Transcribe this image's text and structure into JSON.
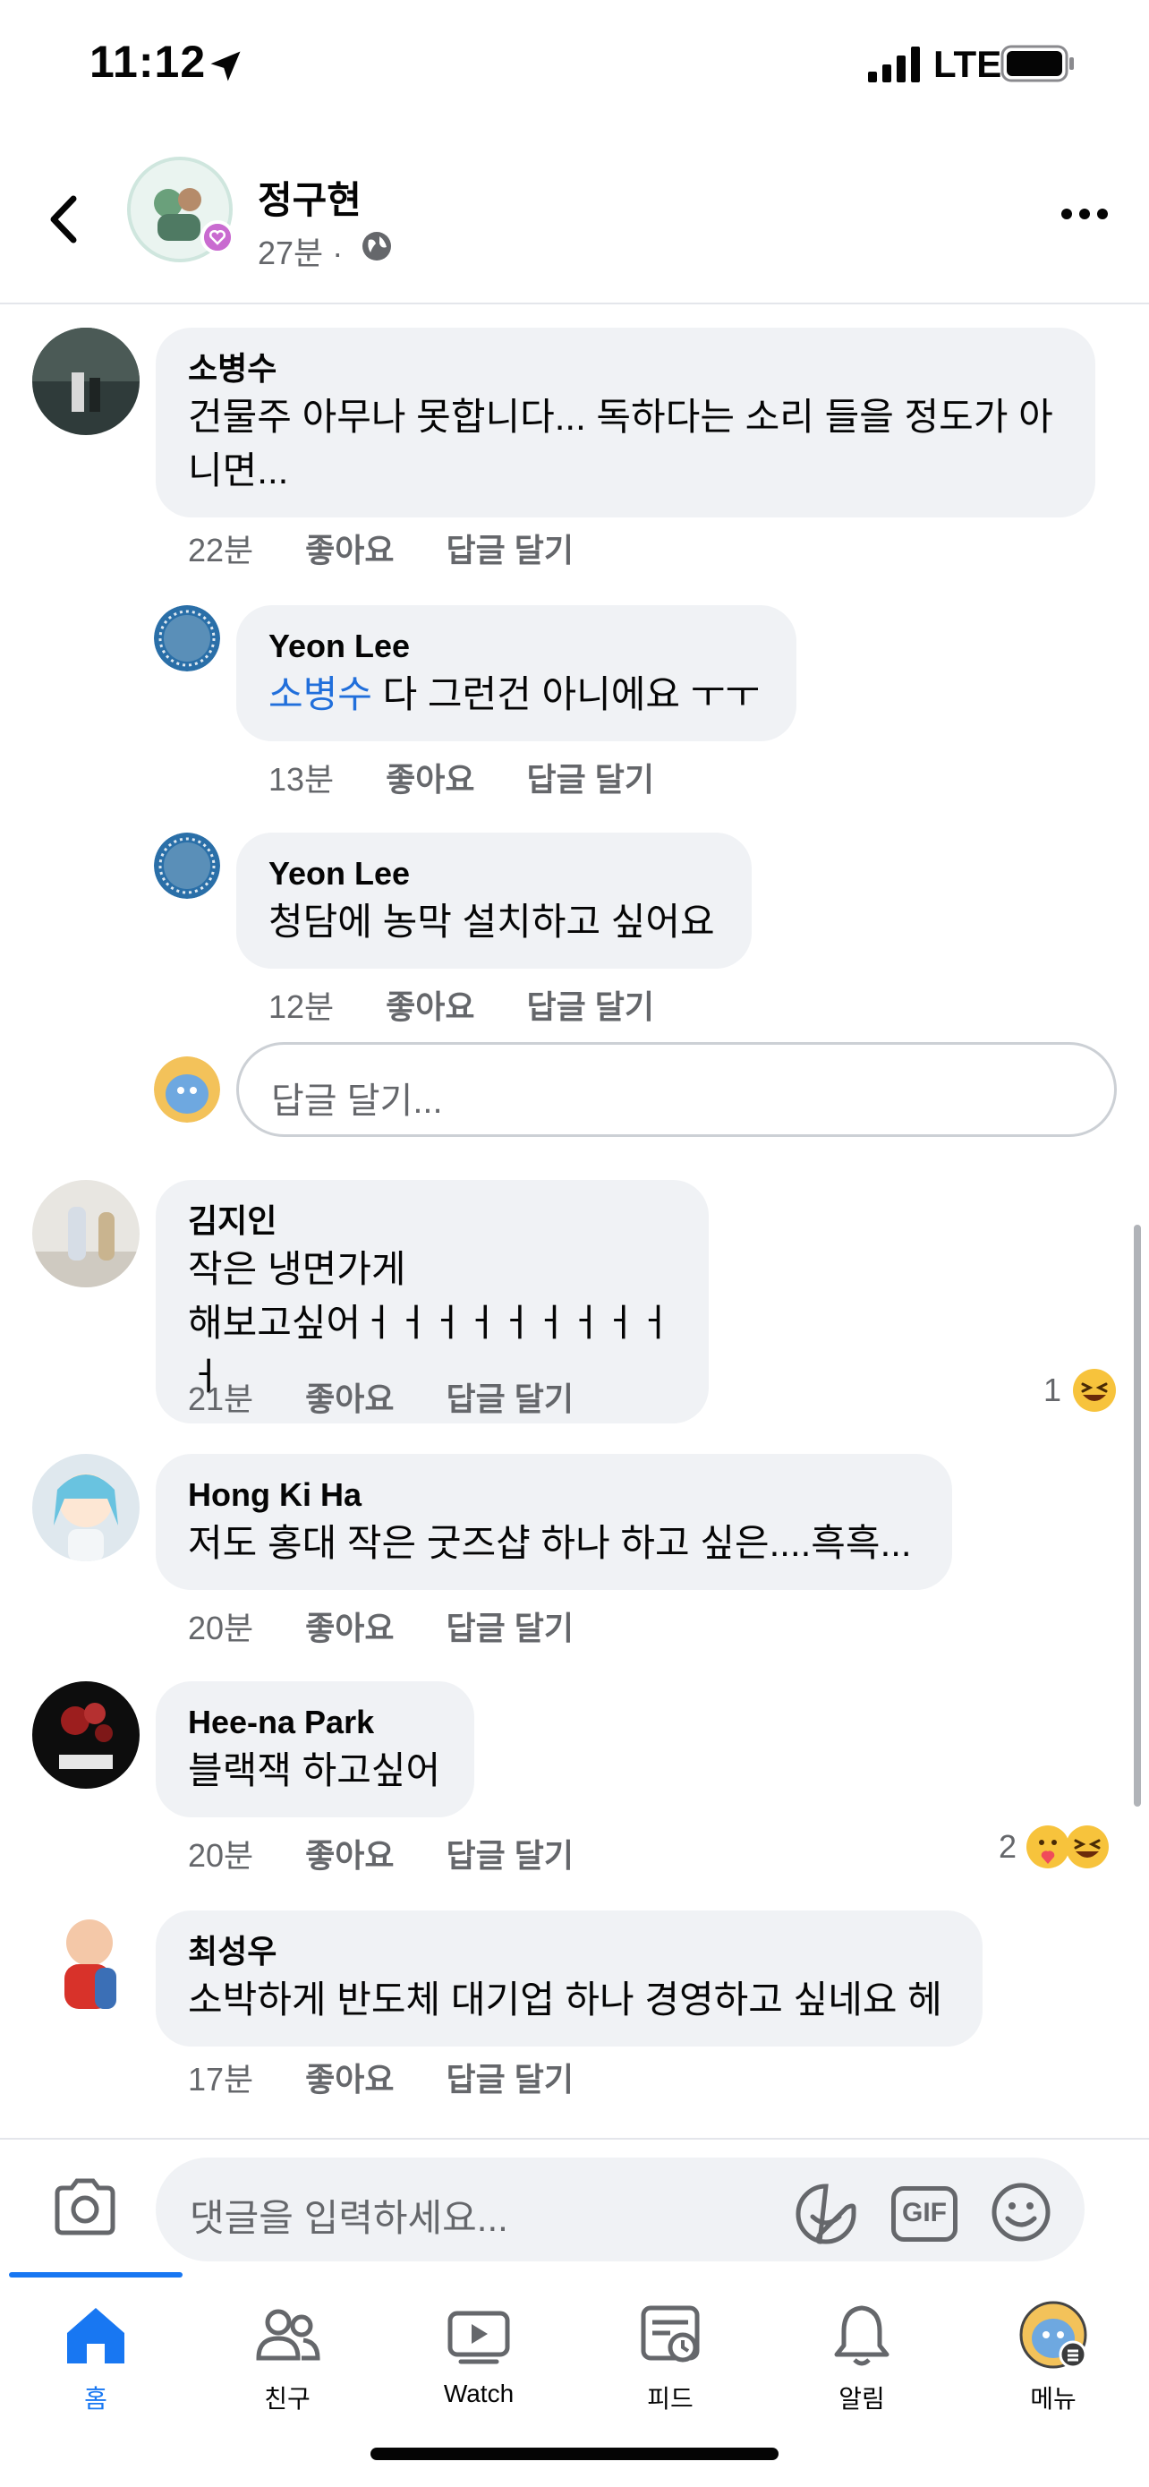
{
  "status_bar": {
    "time": "11:12",
    "network": "LTE"
  },
  "post_header": {
    "author": "정구현",
    "time": "27분",
    "separator": "·"
  },
  "comments": [
    {
      "name": "소병수",
      "lines": [
        "건물주 아무나 못합니다... 독하다는 소리 들을 정도가 아",
        "니면..."
      ],
      "time": "22분",
      "like": "좋아요",
      "reply": "답글 달기"
    },
    {
      "name": "Yeon Lee",
      "mention": "소병수",
      "text": " 다 그런건 아니에요 ㅜㅜ",
      "time": "13분",
      "like": "좋아요",
      "reply": "답글 달기"
    },
    {
      "name": "Yeon Lee",
      "lines": [
        "청담에 농막 설치하고 싶어요"
      ],
      "time": "12분",
      "like": "좋아요",
      "reply": "답글 달기"
    },
    {
      "name": "김지인",
      "lines": [
        "작은 냉면가게",
        "해보고싶어ㅓㅓㅓㅓㅓㅓㅓㅓㅓㅓ"
      ],
      "time": "21분",
      "like": "좋아요",
      "reply": "답글 달기",
      "reaction_count": "1"
    },
    {
      "name": "Hong Ki Ha",
      "lines": [
        "저도 홍대 작은 굿즈샵 하나 하고 싶은....흑흑..."
      ],
      "time": "20분",
      "like": "좋아요",
      "reply": "답글 달기"
    },
    {
      "name": "Hee-na Park",
      "lines": [
        "블랙잭 하고싶어"
      ],
      "time": "20분",
      "like": "좋아요",
      "reply": "답글 달기",
      "reaction_count": "2"
    },
    {
      "name": "최성우",
      "lines": [
        "소박하게 반도체 대기업 하나 경영하고 싶네요 헤"
      ],
      "time": "17분",
      "like": "좋아요",
      "reply": "답글 달기"
    }
  ],
  "reply_input": {
    "placeholder": "답글 달기..."
  },
  "composer": {
    "placeholder": "댓글을 입력하세요...",
    "gif": "GIF"
  },
  "tabs": [
    {
      "label": "홈",
      "icon": "home-icon",
      "active": true
    },
    {
      "label": "친구",
      "icon": "friends-icon"
    },
    {
      "label": "Watch",
      "icon": "watch-icon"
    },
    {
      "label": "피드",
      "icon": "feeds-icon"
    },
    {
      "label": "알림",
      "icon": "bell-icon"
    },
    {
      "label": "메뉴",
      "icon": "menu-avatar-icon"
    }
  ],
  "colors": {
    "accent": "#1877f2",
    "bubble": "#f0f2f5",
    "secondary_text": "#65676b",
    "mention": "#216fdb"
  }
}
